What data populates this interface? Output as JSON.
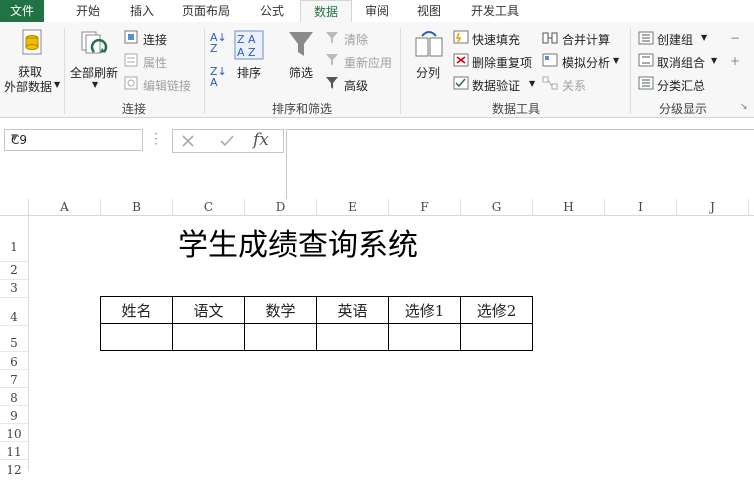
{
  "tabs": [
    "文件",
    "开始",
    "插入",
    "页面布局",
    "公式",
    "数据",
    "审阅",
    "视图",
    "开发工具"
  ],
  "ribbon": {
    "get_external": [
      "获取",
      "外部数据"
    ],
    "refresh_all": "全部刷新",
    "connections": [
      "连接",
      "属性",
      "编辑链接"
    ],
    "connections_label": "连接",
    "sort": "排序",
    "filter": "筛选",
    "filter_items": [
      "清除",
      "重新应用",
      "高级"
    ],
    "sort_filter_label": "排序和筛选",
    "split": "分列",
    "data_tools_items": [
      "快速填充",
      "删除重复项",
      "数据验证"
    ],
    "data_tools_items2": [
      "合并计算",
      "模拟分析",
      "关系"
    ],
    "data_tools_label": "数据工具",
    "outline_items": [
      "创建组",
      "取消组合",
      "分类汇总"
    ],
    "outline_label": "分级显示"
  },
  "formula_bar": {
    "name_box": "C9",
    "fx": "fx",
    "formula": ""
  },
  "sheet": {
    "columns": [
      "A",
      "B",
      "C",
      "D",
      "E",
      "F",
      "G",
      "H",
      "I",
      "J"
    ],
    "rows": [
      "1",
      "2",
      "3",
      "4",
      "5",
      "6",
      "7",
      "8",
      "9",
      "10",
      "11",
      "12"
    ],
    "title": "学生成绩查询系统",
    "table_headers": [
      "姓名",
      "语文",
      "数学",
      "英语",
      "选修1",
      "选修2"
    ]
  },
  "colors": {
    "accent": "#217346"
  }
}
